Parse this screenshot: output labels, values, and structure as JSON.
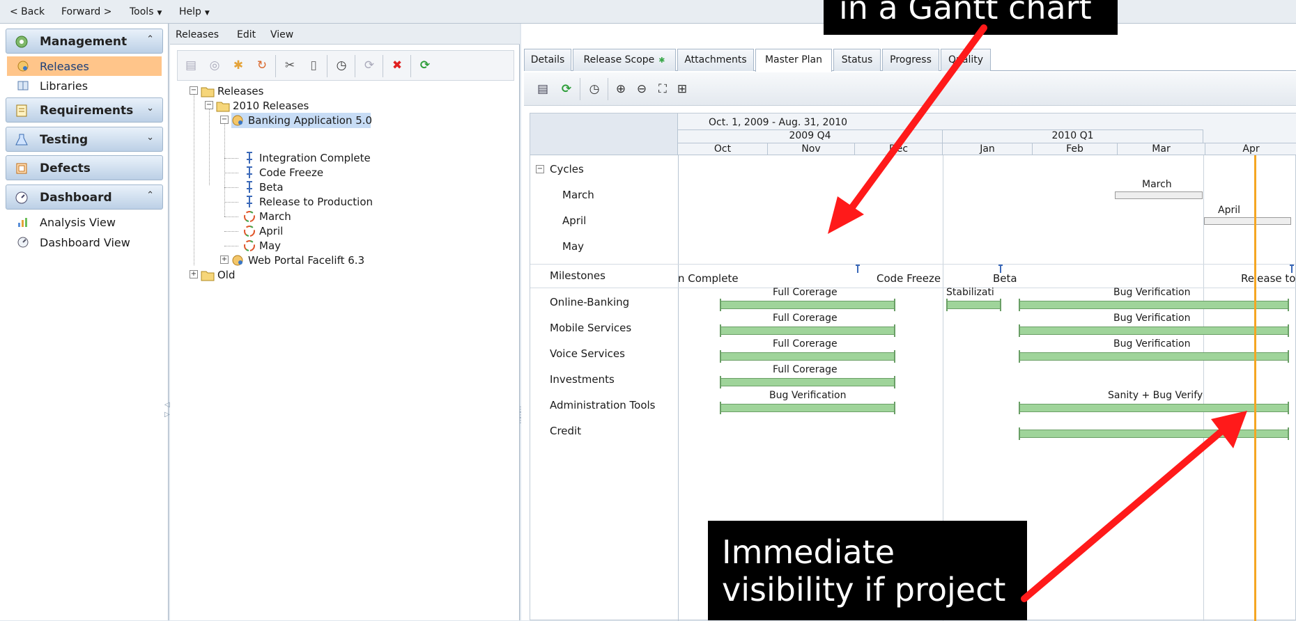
{
  "top_menu": {
    "back": "< Back",
    "forward": "Forward >",
    "tools": "Tools",
    "help": "Help"
  },
  "sidebar": {
    "modules": [
      {
        "label": "Management",
        "chevron": "⌃⌃",
        "icon": "management-icon"
      },
      {
        "label": "Requirements",
        "chevron": "⌄⌄",
        "icon": "requirements-icon"
      },
      {
        "label": "Testing",
        "chevron": "⌄⌄",
        "icon": "testing-icon"
      },
      {
        "label": "Defects",
        "chevron": "",
        "icon": "defects-icon"
      },
      {
        "label": "Dashboard",
        "chevron": "⌃⌃",
        "icon": "dashboard-icon"
      }
    ],
    "management_items": [
      {
        "label": "Releases",
        "selected": true,
        "icon": "releases-icon"
      },
      {
        "label": "Libraries",
        "selected": false,
        "icon": "libraries-icon"
      }
    ],
    "dashboard_items": [
      {
        "label": "Analysis View",
        "icon": "analysis-view-icon"
      },
      {
        "label": "Dashboard View",
        "icon": "dashboard-view-icon"
      }
    ]
  },
  "mid_menu": {
    "releases": "Releases",
    "edit": "Edit",
    "view": "View"
  },
  "mid_toolbar": [
    "new-folder-icon",
    "new-release-icon",
    "new-milestone-icon",
    "new-cycle-icon",
    "cut-icon",
    "paste-icon",
    "schedule-icon",
    "sync-icon",
    "delete-icon",
    "refresh-icon"
  ],
  "tree": {
    "root": "Releases",
    "folder_2010": "2010 Releases",
    "banking": "Banking Application 5.0",
    "milestones": [
      "Integration Complete",
      "Code Freeze",
      "Beta",
      "Release to Production"
    ],
    "cycles": [
      "March",
      "April",
      "May"
    ],
    "web_portal": "Web Portal Facelift 6.3",
    "old": "Old"
  },
  "tabs": [
    {
      "label": "Details",
      "active": false
    },
    {
      "label": "Release Scope",
      "active": false,
      "has_dot": true
    },
    {
      "label": "Attachments",
      "active": false
    },
    {
      "label": "Master Plan",
      "active": true
    },
    {
      "label": "Status",
      "active": false
    },
    {
      "label": "Progress",
      "active": false
    },
    {
      "label": "Quality",
      "active": false
    }
  ],
  "gantt_toolbar": [
    "properties-icon",
    "refresh-icon",
    "schedule-icon",
    "zoom-in-icon",
    "zoom-out-icon",
    "fit-icon",
    "grid-view-icon"
  ],
  "gantt": {
    "date_range": "Oct. 1, 2009 - Aug. 31, 2010",
    "quarters": [
      "2009 Q4",
      "2010 Q1"
    ],
    "months": [
      "Oct",
      "Nov",
      "Dec",
      "Jan",
      "Feb",
      "Mar",
      "Apr"
    ],
    "cycles_header": "Cycles",
    "cycles": [
      "March",
      "April",
      "May"
    ],
    "cycle_bar_labels": {
      "march": "March",
      "april": "April"
    },
    "milestones_label": "Milestones",
    "milestone_labels": [
      "n Complete",
      "Code Freeze",
      "Beta",
      "Release to"
    ],
    "rows": [
      "Online-Banking",
      "Mobile Services",
      "Voice Services",
      "Investments",
      "Administration Tools",
      "Credit"
    ],
    "bar_labels": {
      "online_1": "Full Corerage",
      "online_2": "Stabilizati",
      "online_3": "Bug Verification",
      "mobile_1": "Full Corerage",
      "mobile_2": "Bug Verification",
      "voice_1": "Full Corerage",
      "voice_2": "Bug Verification",
      "invest_1": "Full Corerage",
      "admin_1": "Bug Verification",
      "admin_2": "Sanity + Bug Verify"
    },
    "today_line_color": "#f5a623"
  },
  "callouts": {
    "top": "in a Gantt chart",
    "bottom_line1": "Immediate",
    "bottom_line2": "visibility if project"
  },
  "colors": {
    "arrow": "#ff1a1a",
    "selected_sidebar": "#ffc58a",
    "bar_green": "#9fd49a"
  }
}
